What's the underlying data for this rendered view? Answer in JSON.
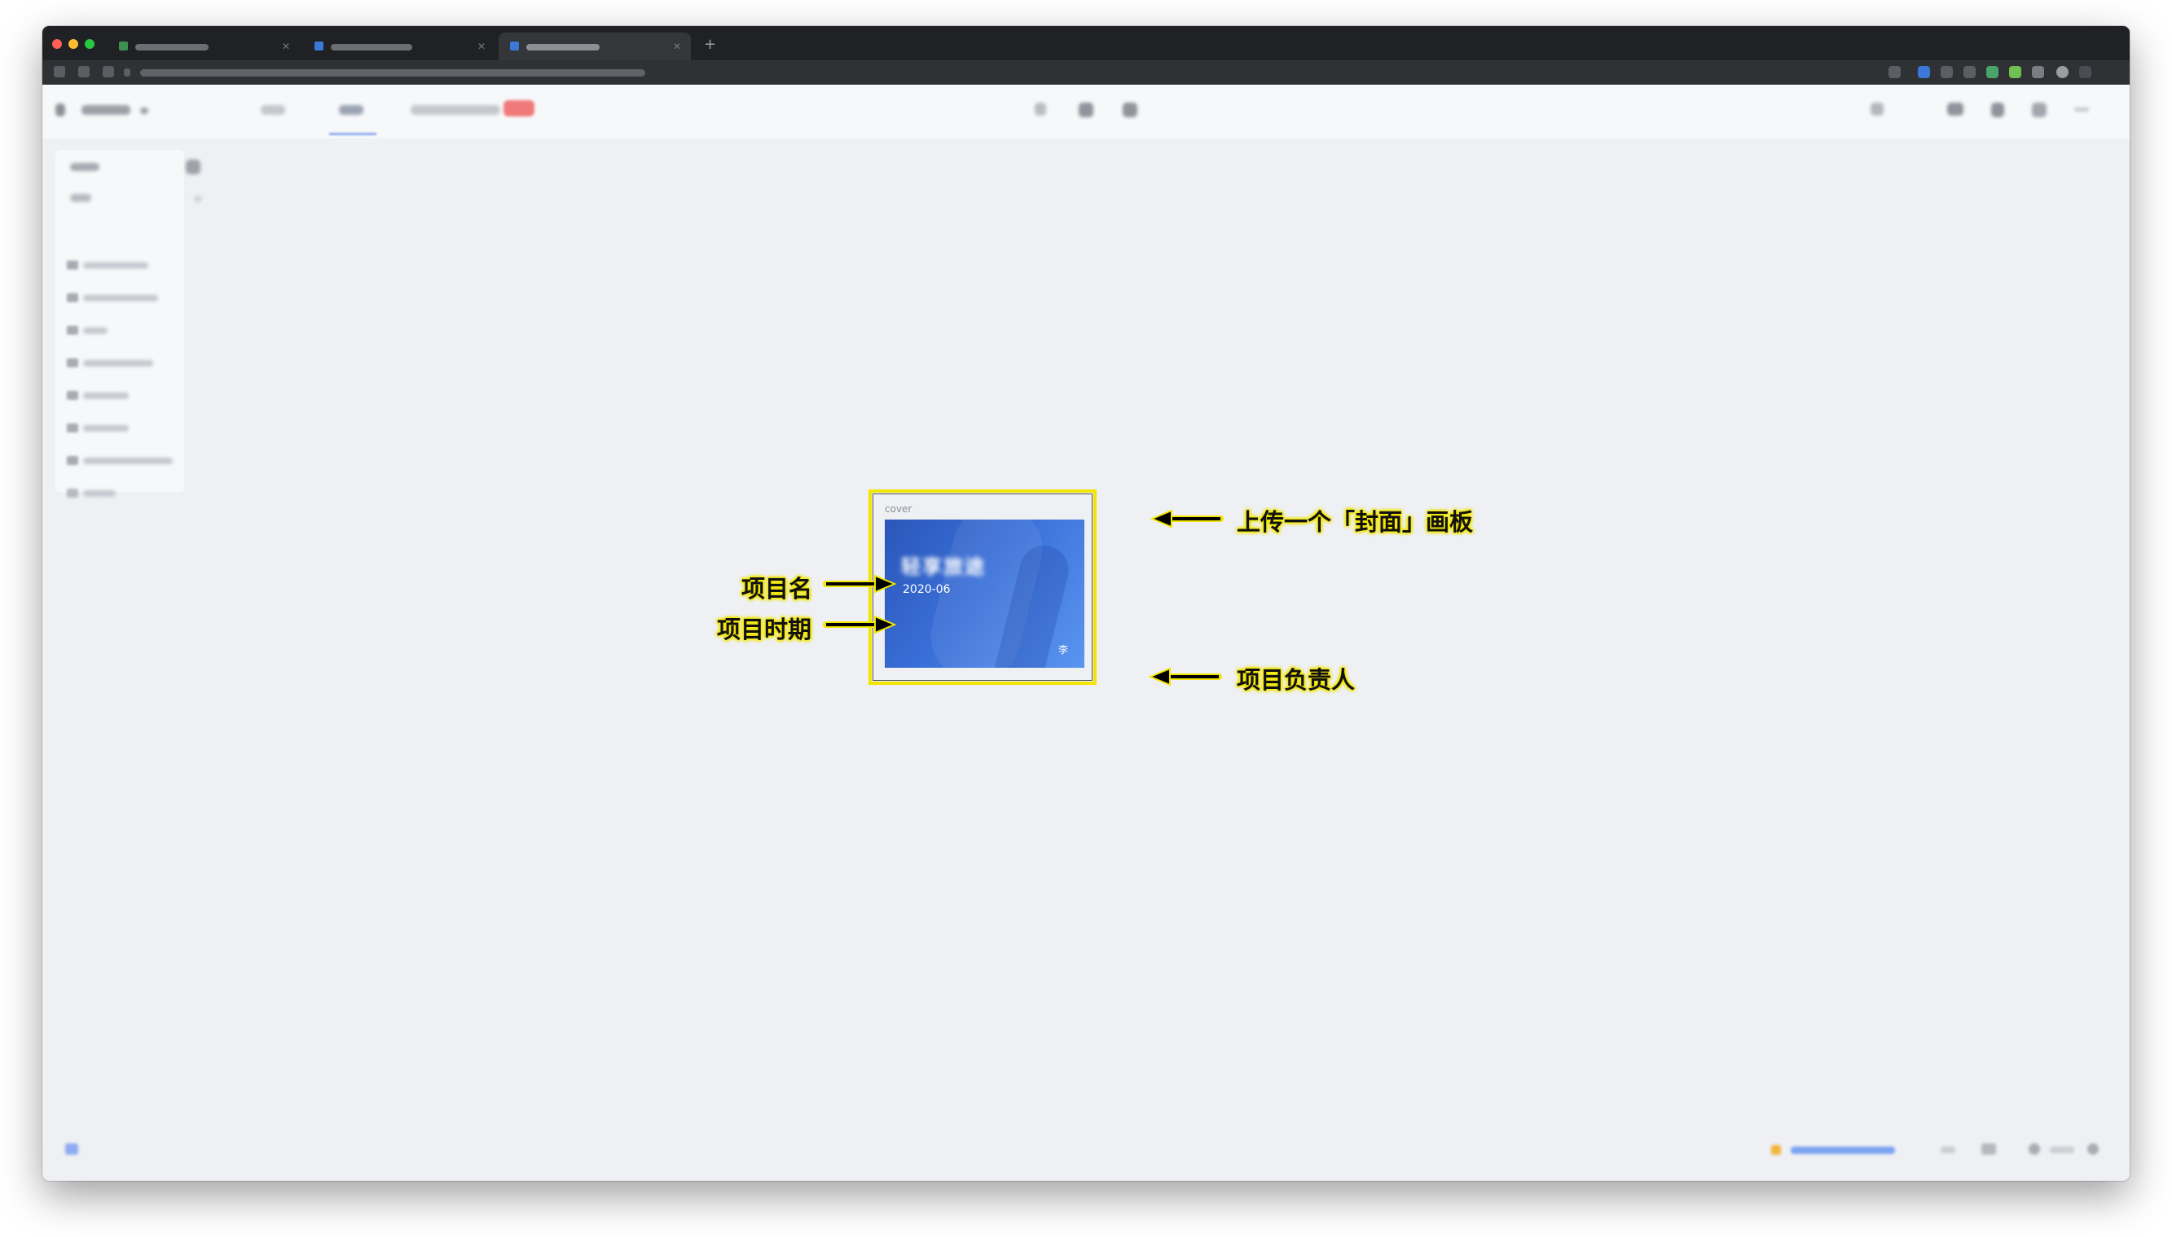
{
  "frame": {
    "label": "cover",
    "project_name": "轻享旅途",
    "project_date": "2020-06",
    "project_owner": "李"
  },
  "annotations": {
    "upload_cover": "上传一个「封面」画板",
    "project_name": "项目名",
    "project_period": "项目时期",
    "project_owner": "项目负责人"
  },
  "colors": {
    "annotation_highlight": "#f2e600",
    "cover_gradient_start": "#2a56b8",
    "cover_gradient_end": "#5a95f0",
    "active_tab_underline": "#8eaaf0",
    "badge": "#f07a7a"
  },
  "icons": {
    "back": "back-icon",
    "pen": "pen-icon",
    "comment": "comment-icon",
    "search": "search-icon",
    "settings": "gear-icon"
  }
}
